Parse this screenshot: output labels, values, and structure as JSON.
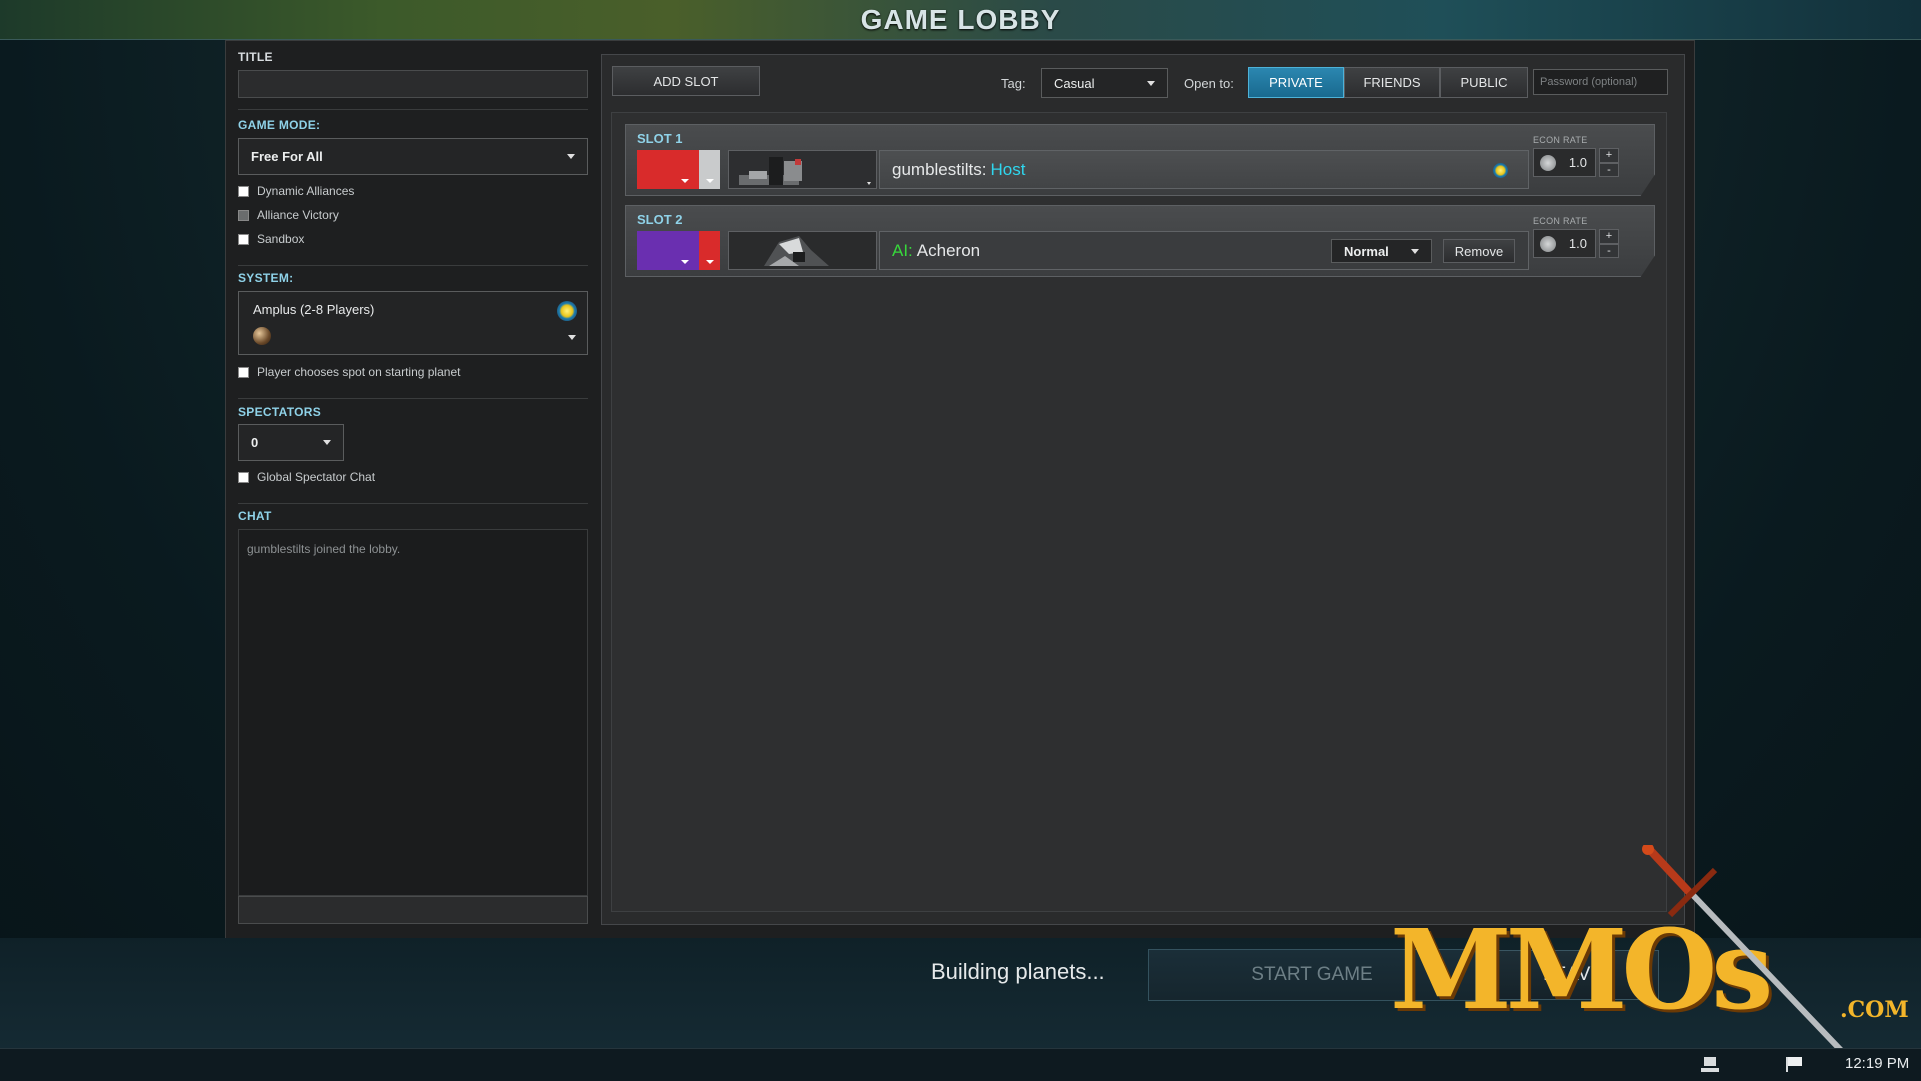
{
  "header": {
    "title": "GAME LOBBY"
  },
  "settings": {
    "title_label": "TITLE",
    "title_value": "",
    "game_mode_label": "GAME MODE:",
    "game_mode_value": "Free For All",
    "options": [
      "Dynamic Alliances",
      "Alliance Victory",
      "Sandbox"
    ],
    "system_label": "SYSTEM:",
    "system_value": "Amplus (2-8 Players)",
    "player_spot_option": "Player chooses spot on starting planet",
    "spectators_label": "SPECTATORS",
    "spectators_value": "0",
    "spectator_chat_option": "Global Spectator Chat",
    "chat_label": "CHAT",
    "chat_messages": [
      "gumblestilts joined the lobby."
    ],
    "chat_input_value": ""
  },
  "toolbar": {
    "add_slot": "ADD SLOT",
    "tag_label": "Tag:",
    "tag_value": "Casual",
    "open_label": "Open to:",
    "visibility_options": [
      "PRIVATE",
      "FRIENDS",
      "PUBLIC"
    ],
    "visibility_selected": "PRIVATE",
    "password_placeholder": "Password (optional)"
  },
  "slots": [
    {
      "title": "SLOT 1",
      "color": "#d92b2b",
      "secondary_color": "#c9cbcc",
      "player": "gumblestilts",
      "separator": " :",
      "role": "Host",
      "econ_label": "ECON RATE",
      "econ_value": "1.0",
      "econ_plus": "+",
      "econ_minus": "-"
    },
    {
      "title": "SLOT 2",
      "color": "#6a2fb0",
      "secondary_color": "#d92b2b",
      "ai_prefix": "AI:",
      "player": "Acheron",
      "difficulty": "Normal",
      "remove": "Remove",
      "econ_label": "ECON RATE",
      "econ_value": "1.0",
      "econ_plus": "+",
      "econ_minus": "-"
    }
  ],
  "footer": {
    "status": "Building planets...",
    "start_game": "START GAME",
    "leave": "LEAVE"
  },
  "taskbar": {
    "clock": "12:19 PM"
  },
  "watermark": {
    "text": "MMOs",
    "suffix": ".COM"
  },
  "colors": {
    "accent": "#2b87b0",
    "host": "#2fd6ee",
    "ai": "#37d83b",
    "slot_label": "#8fd2e8"
  }
}
